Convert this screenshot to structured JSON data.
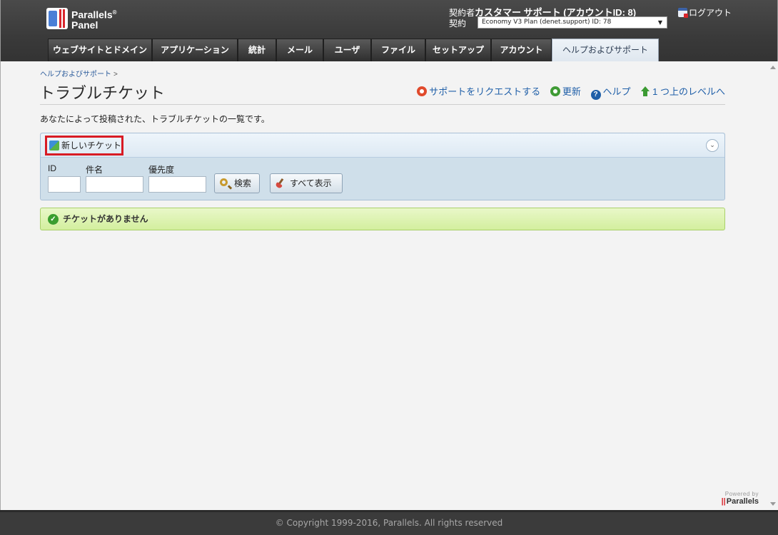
{
  "header": {
    "logo_line1": "Parallels",
    "logo_reg": "®",
    "logo_line2": "Panel",
    "account_label": "契約者",
    "account_name": "カスタマー サポート (アカウントID: 8)",
    "subscription_label": "契約",
    "subscription_value": "Economy V3 Plan (denet.support) ID: 78",
    "logout_label": "ログアウト"
  },
  "tabs": [
    {
      "label": "ウェブサイトとドメイン"
    },
    {
      "label": "アプリケーション"
    },
    {
      "label": "統計"
    },
    {
      "label": "メール"
    },
    {
      "label": "ユーザ"
    },
    {
      "label": "ファイル"
    },
    {
      "label": "セットアップ"
    },
    {
      "label": "アカウント"
    },
    {
      "label": "ヘルプおよびサポート",
      "active": true
    }
  ],
  "breadcrumb": {
    "item": "ヘルプおよびサポート",
    "separator": ">"
  },
  "page": {
    "title": "トラブルチケット",
    "description": "あなたによって投稿された、トラブルチケットの一覧です。"
  },
  "actions": {
    "request_support": "サポートをリクエストする",
    "refresh": "更新",
    "help": "ヘルプ",
    "up_level": "1 つ上のレベルへ"
  },
  "toolbar": {
    "new_ticket": "新しいチケット"
  },
  "filter": {
    "id_label": "ID",
    "subject_label": "件名",
    "priority_label": "優先度",
    "id_value": "",
    "subject_value": "",
    "priority_value": "",
    "search_button": "検索",
    "show_all_button": "すべて表示"
  },
  "notice": {
    "text": "チケットがありません"
  },
  "branding": {
    "powered_by": "Powered by",
    "vendor": "Parallels"
  },
  "footer": {
    "copyright": "© Copyright 1999-2016, Parallels. All rights reserved"
  },
  "colors": {
    "header_bg": "#3a3a3a",
    "active_tab_bg": "#dfe7ef",
    "link": "#1f5fa8",
    "highlight_border": "#d81b24",
    "notice_bg": "#d3ef9e",
    "footer_bg": "#3b3b3b"
  }
}
